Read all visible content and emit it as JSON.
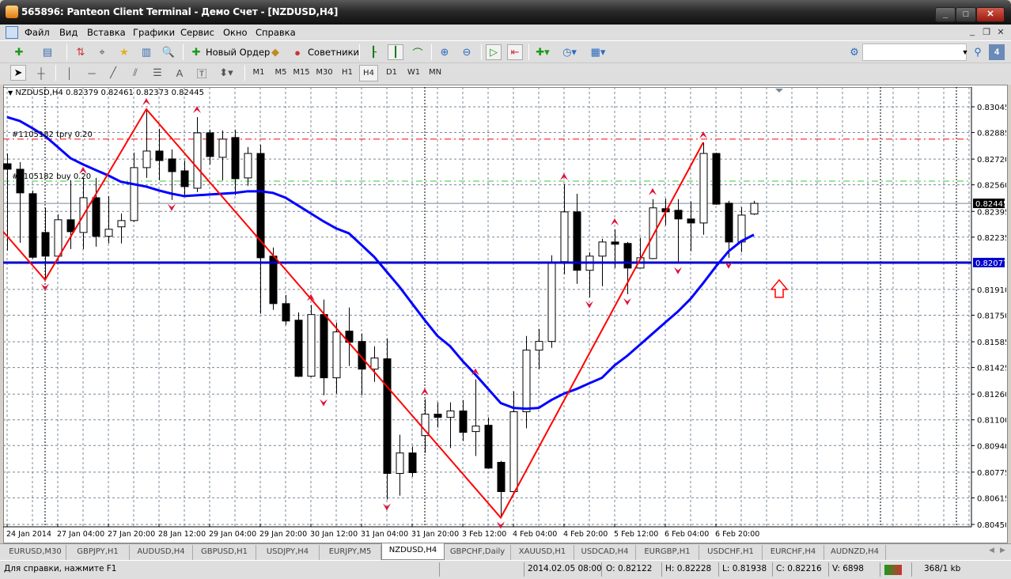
{
  "window": {
    "title": "565896: Panteon Client Terminal - Демо Счет - [NZDUSD,H4]"
  },
  "menu": [
    "Файл",
    "Вид",
    "Вставка",
    "Графики",
    "Сервис",
    "Окно",
    "Справка"
  ],
  "toolbar": {
    "new_order": "Новый Ордер",
    "experts": "Советники",
    "timeframes": [
      "M1",
      "M5",
      "M15",
      "M30",
      "H1",
      "H4",
      "D1",
      "W1",
      "MN"
    ],
    "active_timeframe": "H4",
    "search_value": "",
    "notifications_badge": "4"
  },
  "chart": {
    "header": "NZDUSD,H4  0.82379 0.82461 0.82373 0.82445",
    "order_labels": [
      "#1105182 tpry 0.20",
      "#1105182 buy 0.20"
    ],
    "colors": {
      "bull_body": "#ffffff",
      "bear_body": "#000000",
      "ma": "#0000ff",
      "zigzag": "#ff0000",
      "fractal": "#dc143c",
      "tp_line": "#ff0000",
      "entry_line": "#32cd32",
      "level_line": "#0000cd",
      "bid_line": "#778899",
      "grid": "#778899"
    }
  },
  "chart_data": {
    "type": "candlestick",
    "symbol": "NZDUSD",
    "timeframe": "H4",
    "ylim": [
      0.8045,
      0.83045
    ],
    "price_ticks": [
      "0.83045",
      "0.82885",
      "0.82720",
      "0.82560",
      "0.82395",
      "0.82235",
      "0.81910",
      "0.81750",
      "0.81585",
      "0.81425",
      "0.81260",
      "0.81100",
      "0.80940",
      "0.80775",
      "0.80615",
      "0.80450"
    ],
    "time_labels": [
      {
        "label": "24 Jan 2014",
        "candle": 0
      },
      {
        "label": "27 Jan 04:00",
        "candle": 4
      },
      {
        "label": "27 Jan 20:00",
        "candle": 8
      },
      {
        "label": "28 Jan 12:00",
        "candle": 12
      },
      {
        "label": "29 Jan 04:00",
        "candle": 16
      },
      {
        "label": "29 Jan 20:00",
        "candle": 20
      },
      {
        "label": "30 Jan 12:00",
        "candle": 24
      },
      {
        "label": "31 Jan 04:00",
        "candle": 28
      },
      {
        "label": "31 Jan 20:00",
        "candle": 32
      },
      {
        "label": "3 Feb 12:00",
        "candle": 36
      },
      {
        "label": "4 Feb 04:00",
        "candle": 40
      },
      {
        "label": "4 Feb 20:00",
        "candle": 44
      },
      {
        "label": "5 Feb 12:00",
        "candle": 48
      },
      {
        "label": "6 Feb 04:00",
        "candle": 52
      },
      {
        "label": "6 Feb 20:00",
        "candle": 56
      }
    ],
    "ohlc": [
      [
        0.82691,
        0.82755,
        0.82151,
        0.82657
      ],
      [
        0.82657,
        0.82701,
        0.822,
        0.8251
      ],
      [
        0.82505,
        0.82525,
        0.82102,
        0.8211
      ],
      [
        0.82264,
        0.82417,
        0.8197,
        0.82117
      ],
      [
        0.82117,
        0.82377,
        0.82088,
        0.82343
      ],
      [
        0.82343,
        0.82588,
        0.82161,
        0.82269
      ],
      [
        0.82264,
        0.82603,
        0.82161,
        0.8248
      ],
      [
        0.8248,
        0.82603,
        0.82176,
        0.8224
      ],
      [
        0.8224,
        0.8249,
        0.82196,
        0.82284
      ],
      [
        0.82299,
        0.82382,
        0.82196,
        0.82338
      ],
      [
        0.82338,
        0.8276,
        0.8233,
        0.82667
      ],
      [
        0.82667,
        0.8303,
        0.82603,
        0.8277
      ],
      [
        0.8277,
        0.82908,
        0.82588,
        0.82711
      ],
      [
        0.82721,
        0.8278,
        0.82466,
        0.82642
      ],
      [
        0.82647,
        0.82711,
        0.82495,
        0.82549
      ],
      [
        0.82539,
        0.82981,
        0.82515,
        0.82883
      ],
      [
        0.82883,
        0.82903,
        0.82687,
        0.82736
      ],
      [
        0.82731,
        0.82898,
        0.82588,
        0.82844
      ],
      [
        0.82854,
        0.82903,
        0.82495,
        0.82598
      ],
      [
        0.82603,
        0.82795,
        0.82554,
        0.82755
      ],
      [
        0.82755,
        0.82809,
        0.81759,
        0.82107
      ],
      [
        0.82117,
        0.82171,
        0.81783,
        0.81822
      ],
      [
        0.81822,
        0.81876,
        0.8169,
        0.81714
      ],
      [
        0.81719,
        0.81768,
        0.81366,
        0.8137
      ],
      [
        0.81371,
        0.81813,
        0.81366,
        0.81754
      ],
      [
        0.81754,
        0.81847,
        0.81253,
        0.81361
      ],
      [
        0.81361,
        0.81705,
        0.81263,
        0.81646
      ],
      [
        0.81651,
        0.81798,
        0.81435,
        0.81582
      ],
      [
        0.81587,
        0.81636,
        0.81253,
        0.81415
      ],
      [
        0.81415,
        0.81557,
        0.81336,
        0.81484
      ],
      [
        0.81479,
        0.81606,
        0.80605,
        0.80767
      ],
      [
        0.80767,
        0.81007,
        0.80629,
        0.80894
      ],
      [
        0.80894,
        0.80934,
        0.80747,
        0.80772
      ],
      [
        0.81002,
        0.81228,
        0.80894,
        0.81135
      ],
      [
        0.81135,
        0.81209,
        0.81052,
        0.81115
      ],
      [
        0.81115,
        0.81209,
        0.80924,
        0.81155
      ],
      [
        0.81155,
        0.81223,
        0.80968,
        0.81022
      ],
      [
        0.81027,
        0.81351,
        0.80875,
        0.81061
      ],
      [
        0.81066,
        0.81115,
        0.80796,
        0.808
      ],
      [
        0.80836,
        0.80845,
        0.80492,
        0.80654
      ],
      [
        0.80654,
        0.81277,
        0.8065,
        0.8115
      ],
      [
        0.8115,
        0.81621,
        0.81047,
        0.81533
      ],
      [
        0.81533,
        0.81665,
        0.81415,
        0.81587
      ],
      [
        0.81587,
        0.82122,
        0.81547,
        0.82078
      ],
      [
        0.82083,
        0.82564,
        0.82004,
        0.82392
      ],
      [
        0.82392,
        0.82505,
        0.81945,
        0.82029
      ],
      [
        0.82029,
        0.82142,
        0.81862,
        0.82117
      ],
      [
        0.82117,
        0.82225,
        0.8193,
        0.82205
      ],
      [
        0.82205,
        0.82284,
        0.82043,
        0.82191
      ],
      [
        0.82196,
        0.82205,
        0.81881,
        0.82043
      ],
      [
        0.82043,
        0.8223,
        0.8204,
        0.82107
      ],
      [
        0.82102,
        0.82471,
        0.82098,
        0.82417
      ],
      [
        0.82412,
        0.82475,
        0.82309,
        0.82392
      ],
      [
        0.82402,
        0.82471,
        0.82073,
        0.82348
      ],
      [
        0.82348,
        0.82456,
        0.82147,
        0.82323
      ],
      [
        0.82323,
        0.82824,
        0.8225,
        0.82755
      ],
      [
        0.82755,
        0.8276,
        0.82436,
        0.8244
      ],
      [
        0.82446,
        0.82461,
        0.82107,
        0.82205
      ],
      [
        0.82205,
        0.82421,
        0.82142,
        0.82372
      ],
      [
        0.82379,
        0.82461,
        0.82373,
        0.82445
      ]
    ],
    "moving_average": [
      0.82981,
      0.82957,
      0.82912,
      0.82863,
      0.82795,
      0.82726,
      0.82687,
      0.82652,
      0.82618,
      0.82579,
      0.82564,
      0.82549,
      0.82525,
      0.82505,
      0.8249,
      0.82495,
      0.825,
      0.82505,
      0.8251,
      0.8252,
      0.8252,
      0.8251,
      0.8248,
      0.82431,
      0.82382,
      0.82333,
      0.82289,
      0.82259,
      0.82186,
      0.82112,
      0.82019,
      0.81926,
      0.81822,
      0.81719,
      0.81621,
      0.81557,
      0.81464,
      0.81381,
      0.81292,
      0.81204,
      0.81174,
      0.81169,
      0.81174,
      0.81223,
      0.81263,
      0.81292,
      0.81327,
      0.81361,
      0.81439,
      0.81498,
      0.81567,
      0.81636,
      0.81705,
      0.81773,
      0.81852,
      0.8195,
      0.82053,
      0.82147,
      0.8221,
      0.8225
    ],
    "zigzag": [
      [
        0,
        0.82269
      ],
      [
        3,
        0.8197
      ],
      [
        11,
        0.8303
      ],
      [
        39,
        0.80492
      ],
      [
        55,
        0.82824
      ]
    ],
    "fractals_up": [
      6,
      11,
      15,
      24,
      33,
      37,
      44,
      48,
      51,
      55
    ],
    "fractals_down": [
      3,
      13,
      25,
      30,
      39,
      46,
      49,
      53,
      57
    ],
    "levels": {
      "take_profit": 0.82844,
      "entry": 0.82583,
      "horizontal": 0.82077,
      "bid": 0.82445
    },
    "level_labels": {
      "horizontal": "0.82077",
      "bid": "0.82445"
    },
    "grid": true
  },
  "tabs": [
    "EURUSD,M30",
    "GBPJPY,H1",
    "AUDUSD,H4",
    "GBPUSD,H1",
    "USDJPY,H4",
    "EURJPY,M5",
    "NZDUSD,H4",
    "GBPCHF,Daily",
    "XAUUSD,H1",
    "USDCAD,H4",
    "EURGBP,H1",
    "USDCHF,H1",
    "EURCHF,H4",
    "AUDNZD,H4"
  ],
  "active_tab": "NZDUSD,H4",
  "status": {
    "help": "Для справки, нажмите F1",
    "time": "2014.02.05 08:00",
    "open": "O: 0.82122",
    "high": "H: 0.82228",
    "low": "L: 0.81938",
    "close": "C: 0.82216",
    "volume": "V: 6898",
    "traffic": "368/1 kb"
  }
}
